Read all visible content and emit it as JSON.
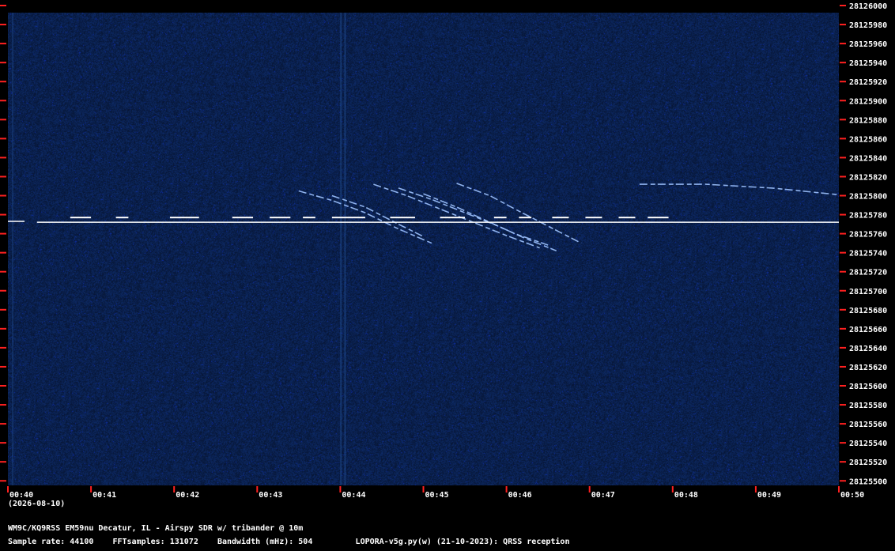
{
  "chart_data": {
    "type": "heatmap",
    "description_axis": "waterfall",
    "x_ticks": [
      "00:40",
      "00:41",
      "00:42",
      "00:43",
      "00:44",
      "00:45",
      "00:46",
      "00:47",
      "00:48",
      "00:49",
      "00:50"
    ],
    "y_ticks": [
      28126000,
      28125980,
      28125960,
      28125940,
      28125920,
      28125900,
      28125880,
      28125860,
      28125840,
      28125820,
      28125800,
      28125780,
      28125760,
      28125740,
      28125720,
      28125700,
      28125680,
      28125660,
      28125640,
      28125620,
      28125600,
      28125580,
      28125560,
      28125540,
      28125520,
      28125500
    ],
    "ylim": [
      28125490,
      28126000
    ],
    "xlim_minutes": [
      0,
      10
    ],
    "grid": false,
    "colors": {
      "background": "#0b2150",
      "signal": "#ffffff",
      "trace": "#9fc3ff",
      "tick": "#ff2020",
      "frame": "#000000"
    },
    "carrier": {
      "frequency_hz": 28125773,
      "start_minute": 0.35,
      "end_minute": 10,
      "key_up_frequency_hz": 28125777,
      "key_down_frequency_hz": 28125772,
      "segments": [
        [
          0.75,
          1.0
        ],
        [
          1.3,
          1.45
        ],
        [
          1.95,
          2.3
        ],
        [
          2.7,
          2.95
        ],
        [
          3.15,
          3.4
        ],
        [
          3.55,
          3.7
        ],
        [
          3.9,
          4.3
        ],
        [
          4.6,
          4.9
        ],
        [
          5.2,
          5.5
        ],
        [
          5.85,
          6.0
        ],
        [
          6.15,
          6.3
        ],
        [
          6.55,
          6.75
        ],
        [
          6.95,
          7.15
        ],
        [
          7.35,
          7.55
        ],
        [
          7.7,
          7.95
        ]
      ]
    },
    "doppler_traces": [
      {
        "points": [
          [
            3.5,
            28125805
          ],
          [
            3.9,
            28125795
          ],
          [
            4.3,
            28125782
          ],
          [
            4.7,
            28125765
          ],
          [
            5.1,
            28125750
          ]
        ]
      },
      {
        "points": [
          [
            3.9,
            28125800
          ],
          [
            4.3,
            28125788
          ],
          [
            4.7,
            28125770
          ],
          [
            5.0,
            28125757
          ]
        ]
      },
      {
        "points": [
          [
            4.4,
            28125812
          ],
          [
            4.8,
            28125800
          ],
          [
            5.2,
            28125786
          ],
          [
            5.6,
            28125772
          ],
          [
            6.0,
            28125758
          ],
          [
            6.4,
            28125745
          ]
        ]
      },
      {
        "points": [
          [
            4.7,
            28125808
          ],
          [
            5.1,
            28125796
          ],
          [
            5.5,
            28125782
          ],
          [
            5.9,
            28125768
          ],
          [
            6.2,
            28125756
          ],
          [
            6.6,
            28125742
          ]
        ]
      },
      {
        "points": [
          [
            5.0,
            28125802
          ],
          [
            5.4,
            28125788
          ],
          [
            5.8,
            28125772
          ],
          [
            6.1,
            28125760
          ],
          [
            6.5,
            28125748
          ]
        ]
      },
      {
        "points": [
          [
            5.4,
            28125813
          ],
          [
            5.8,
            28125800
          ],
          [
            6.1,
            28125786
          ],
          [
            6.5,
            28125768
          ],
          [
            6.9,
            28125750
          ]
        ]
      },
      {
        "points": [
          [
            7.6,
            28125812
          ],
          [
            8.4,
            28125812
          ],
          [
            9.2,
            28125808
          ],
          [
            10.0,
            28125801
          ]
        ]
      }
    ],
    "vertical_streaks_minutes": [
      4.0,
      4.05,
      0.05
    ]
  },
  "date_label": "(2026-08-10)",
  "footer": {
    "station": "WM9C/KQ9RSS EM59nu Decatur, IL - Airspy SDR w/ tribander @ 10m",
    "sample_rate": "Sample rate: 44100",
    "fft_samples": "FFTsamples: 131072",
    "bandwidth": "Bandwidth (mHz): 504",
    "software": "LOPORA-v5g.py(w) (21-10-2023): QRSS reception"
  }
}
